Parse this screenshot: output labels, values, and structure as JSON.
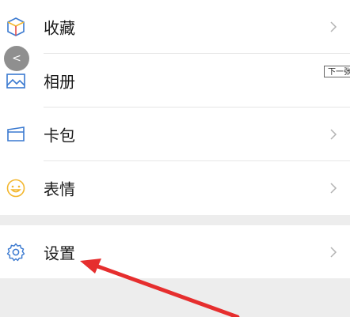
{
  "menu": {
    "items": [
      {
        "label": "收藏",
        "icon": "favorites-cube-icon"
      },
      {
        "label": "相册",
        "icon": "album-image-icon"
      },
      {
        "label": "卡包",
        "icon": "card-wallet-icon"
      },
      {
        "label": "表情",
        "icon": "smiley-face-icon"
      }
    ],
    "settings": {
      "label": "设置",
      "icon": "gear-icon"
    }
  },
  "overlay": {
    "tooltip_text": "下一张",
    "back_button_glyph": "<"
  },
  "colors": {
    "page_bg": "#ededed",
    "row_bg": "#ffffff",
    "arrow": "#e62e2e",
    "icon_blue": "#3a79d0",
    "icon_yellow": "#f3b62c",
    "chevron": "#b3b3b3"
  }
}
